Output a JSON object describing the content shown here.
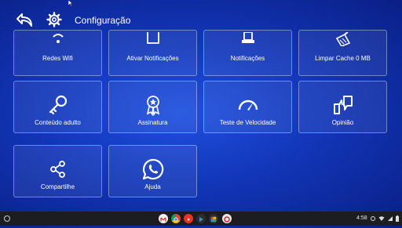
{
  "header": {
    "title": "Configuração",
    "back_icon": "back-arrow-icon",
    "settings_icon": "gear-icon"
  },
  "tiles": [
    {
      "label": "Redes Wifi",
      "icon": "wifi-icon"
    },
    {
      "label": "Ativar Notificações",
      "icon": "notification-toggle-icon"
    },
    {
      "label": "Notificações",
      "icon": "notifications-icon"
    },
    {
      "label": "Limpar Cache 0 MB",
      "icon": "broom-icon"
    },
    {
      "label": "Conteúdo adulto",
      "icon": "key-icon"
    },
    {
      "label": "Assinatura",
      "icon": "award-ribbon-icon"
    },
    {
      "label": "Teste de Velocidade",
      "icon": "speedometer-icon"
    },
    {
      "label": "Opinião",
      "icon": "thumbs-feedback-icon"
    },
    {
      "label": "Compartilhe",
      "icon": "share-icon"
    },
    {
      "label": "Ajuda",
      "icon": "whatsapp-icon"
    }
  ],
  "shelf": {
    "time": "4:58",
    "apps": [
      "gmail-icon",
      "chrome-icon",
      "youtube-icon",
      "play-store-icon",
      "photos-icon",
      "app-icon"
    ]
  },
  "colors": {
    "background": "#1236b8",
    "tile_border": "rgba(255,255,255,0.38)",
    "shelf": "#1b1d21"
  }
}
